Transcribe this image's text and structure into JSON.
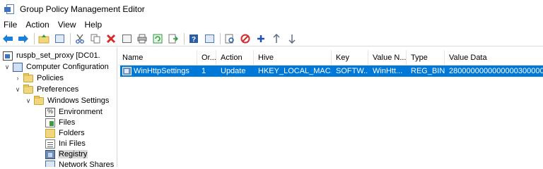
{
  "window": {
    "title": "Group Policy Management Editor"
  },
  "menu": [
    "File",
    "Action",
    "View",
    "Help"
  ],
  "toolbar": {
    "icons": [
      "back-arrow-icon",
      "forward-arrow-icon",
      "up-folder-icon",
      "show-hide-tree-icon",
      "cut-icon",
      "copy-icon",
      "delete-icon",
      "properties-icon",
      "print-icon",
      "refresh-icon",
      "export-list-icon",
      "help-icon",
      "show-action-pane-icon",
      "display-xml-icon",
      "disable-icon",
      "add-icon",
      "move-up-icon",
      "move-down-icon"
    ],
    "colors": {
      "back": "#1c7fd6",
      "forward": "#1c7fd6",
      "cut": "#3f6fb5",
      "delete": "#d62b2b",
      "refresh": "#2f9a40",
      "help": "#2a5fa8",
      "disable": "#d62b2b",
      "add": "#1f4fb6",
      "move": "#5d6f86"
    }
  },
  "tree": {
    "root": "ruspb_set_proxy [DC01.",
    "computer_configuration": "Computer Configuration",
    "policies": "Policies",
    "preferences": "Preferences",
    "windows_settings": "Windows Settings",
    "environment": "Environment",
    "files": "Files",
    "folders": "Folders",
    "ini_files": "Ini Files",
    "registry": "Registry",
    "network_shares": "Network Shares"
  },
  "list": {
    "columns": [
      "Name",
      "Or...",
      "Action",
      "Hive",
      "Key",
      "Value N...",
      "Type",
      "Value Data"
    ],
    "rows": [
      {
        "name": "WinHttpSettings",
        "order": "1",
        "action": "Update",
        "hive": "HKEY_LOCAL_MAC...",
        "key": "SOFTW...",
        "value_name": "WinHtt...",
        "type": "REG_BIN...",
        "value_data": "28000000000000003000000"
      }
    ],
    "selection_color": "#0078d7"
  }
}
